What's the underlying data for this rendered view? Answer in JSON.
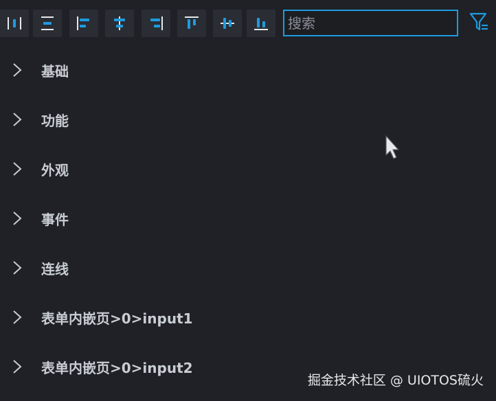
{
  "toolbar": {
    "buttons": [
      {
        "icon": "distribute-horizontal-icon"
      },
      {
        "icon": "distribute-vertical-icon"
      },
      {
        "icon": "align-left-icon"
      },
      {
        "icon": "align-center-horizontal-icon"
      },
      {
        "icon": "align-right-icon"
      },
      {
        "icon": "align-top-icon"
      },
      {
        "icon": "align-middle-vertical-icon"
      },
      {
        "icon": "align-bottom-icon"
      }
    ],
    "search": {
      "placeholder": "搜索",
      "value": ""
    },
    "filter_icon": "filter-icon"
  },
  "tree": {
    "items": [
      {
        "label": "基础",
        "expanded": false
      },
      {
        "label": "功能",
        "expanded": false
      },
      {
        "label": "外观",
        "expanded": false
      },
      {
        "label": "事件",
        "expanded": false
      },
      {
        "label": "连线",
        "expanded": false
      },
      {
        "label": "表单内嵌页>0>input1",
        "expanded": false
      },
      {
        "label": "表单内嵌页>0>input2",
        "expanded": false
      }
    ]
  },
  "watermark": "掘金技术社区 @ UIOTOS硫火",
  "colors": {
    "accent": "#1e9be0",
    "background": "#1f2126",
    "button_bg": "#2a2d33",
    "text": "#c9cdd4"
  }
}
